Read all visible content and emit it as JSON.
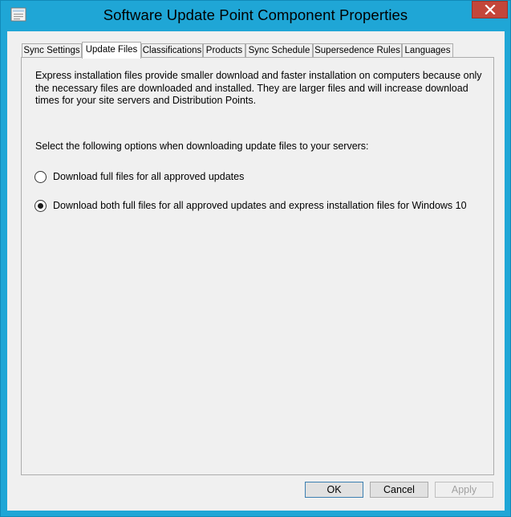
{
  "window": {
    "title": "Software Update Point Component Properties",
    "icon": "properties-icon",
    "close_icon": "close-icon"
  },
  "tabs": [
    {
      "label": "Sync Settings",
      "active": false
    },
    {
      "label": "Update Files",
      "active": true
    },
    {
      "label": "Classifications",
      "active": false
    },
    {
      "label": "Products",
      "active": false
    },
    {
      "label": "Sync Schedule",
      "active": false
    },
    {
      "label": "Supersedence Rules",
      "active": false
    },
    {
      "label": "Languages",
      "active": false
    }
  ],
  "panel": {
    "description": "Express installation files provide smaller download and faster installation on computers because only the necessary files are downloaded and installed.  They are larger files and will increase download times for your site servers and Distribution Points.",
    "prompt": "Select the following options when downloading update files to your servers:",
    "options": [
      {
        "label": "Download full files for all approved updates",
        "selected": false
      },
      {
        "label": "Download both full files for all approved updates and express installation files for Windows 10",
        "selected": true
      }
    ]
  },
  "buttons": {
    "ok": "OK",
    "cancel": "Cancel",
    "apply": "Apply",
    "apply_enabled": false
  },
  "colors": {
    "frame": "#1fa6d6",
    "close": "#c4463a",
    "client": "#f0f0f0"
  }
}
